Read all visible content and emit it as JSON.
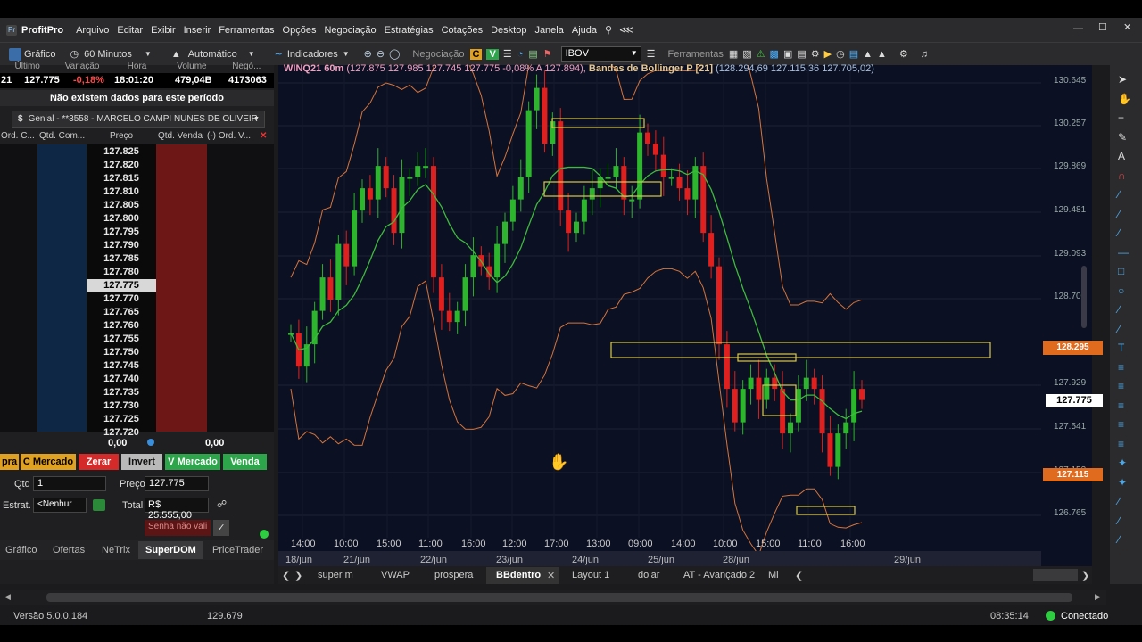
{
  "app": {
    "title": "ProfitPro"
  },
  "menu": [
    "Arquivo",
    "Editar",
    "Exibir",
    "Inserir",
    "Ferramentas",
    "Opções",
    "Negociação",
    "Estratégias",
    "Cotações",
    "Desktop",
    "Janela",
    "Ajuda"
  ],
  "toolbar": {
    "grafico": "Gráfico",
    "periodo": "60 Minutos",
    "modo": "Automático",
    "indicadores": "Indicadores",
    "negociacao": "Negociação",
    "c": "C",
    "v": "V",
    "ativo": "IBOV",
    "ferramentas": "Ferramentas"
  },
  "quote": {
    "headers": [
      "Último",
      "Variação",
      "Hora",
      "Volume",
      "Negó..."
    ],
    "prefix": "21",
    "last": "127.775",
    "var": "-0,18%",
    "hora": "18:01:20",
    "volume": "479,04B",
    "negocios": "4173063"
  },
  "dom": {
    "nodata": "Não existem dados para este período",
    "account_icon": "$",
    "account": "Genial - **3558 - MARCELO CAMPI NUNES DE OLIVEIR",
    "cols": [
      "Ord. C...",
      "Qtd. Com...",
      "Preço",
      "Qtd. Venda",
      "(-) Ord. V..."
    ],
    "prices": [
      "127.825",
      "127.820",
      "127.815",
      "127.810",
      "127.805",
      "127.800",
      "127.795",
      "127.790",
      "127.785",
      "127.780",
      "127.775",
      "127.770",
      "127.765",
      "127.760",
      "127.755",
      "127.750",
      "127.745",
      "127.740",
      "127.735",
      "127.730",
      "127.725",
      "127.720"
    ],
    "tot_left": "0,00",
    "tot_right": "0,00",
    "buttons": {
      "pra": "pra",
      "cmercado": "C Mercado",
      "zerar": "Zerar",
      "invert": "Invert",
      "vmercado": "V Mercado",
      "venda": "Venda"
    },
    "qtd_label": "Qtd",
    "qtd": "1",
    "preco_label": "Preço",
    "preco": "127.775",
    "estrat_label": "Estrat.",
    "estrat": "<Nenhur",
    "total_label": "Total",
    "total": "R$ 25.555,00",
    "senha": "Senha não vali"
  },
  "panel_tabs": [
    "Gráfico",
    "Ofertas",
    "NeTrix",
    "SuperDOM",
    "PriceTrader"
  ],
  "chart": {
    "header": "WINQ21 60m",
    "ohlc": "(127.875  127.985  127.745  127.775  -0,08%  A 127.894),",
    "bb_label": "Bandas de Bollinger P [21]",
    "bb_values": "(128.294,69  127.115,36  127.705,02)",
    "yticks": [
      "130.645",
      "130.257",
      "129.869",
      "129.481",
      "129.093",
      "128.70",
      "127.929",
      "127.541",
      "127.153",
      "126.765"
    ],
    "marker_upper": "128.295",
    "marker_last": "127.775",
    "marker_lower": "127.115",
    "xticks": [
      "14:00",
      "10:00",
      "15:00",
      "11:00",
      "16:00",
      "12:00",
      "17:00",
      "13:00",
      "09:00",
      "14:00",
      "10:00",
      "15:00",
      "11:00",
      "16:00"
    ],
    "dates": [
      "18/jun",
      "21/jun",
      "22/jun",
      "23/jun",
      "24/jun",
      "25/jun",
      "28/jun",
      "29/jun"
    ]
  },
  "chart_tabs": [
    "super m",
    "VWAP",
    "prospera",
    "BBdentro",
    "Layout 1",
    "dolar",
    "AT - Avançado 2",
    "Mi"
  ],
  "status": {
    "version": "Versão 5.0.0.184",
    "value": "129.679",
    "time": "08:35:14",
    "conn": "Conectado"
  },
  "colors": {
    "up": "#2db52d",
    "down": "#e0201e",
    "bb": "#d6743c",
    "ma": "#3dbb3d",
    "box": "#d9c94a"
  }
}
